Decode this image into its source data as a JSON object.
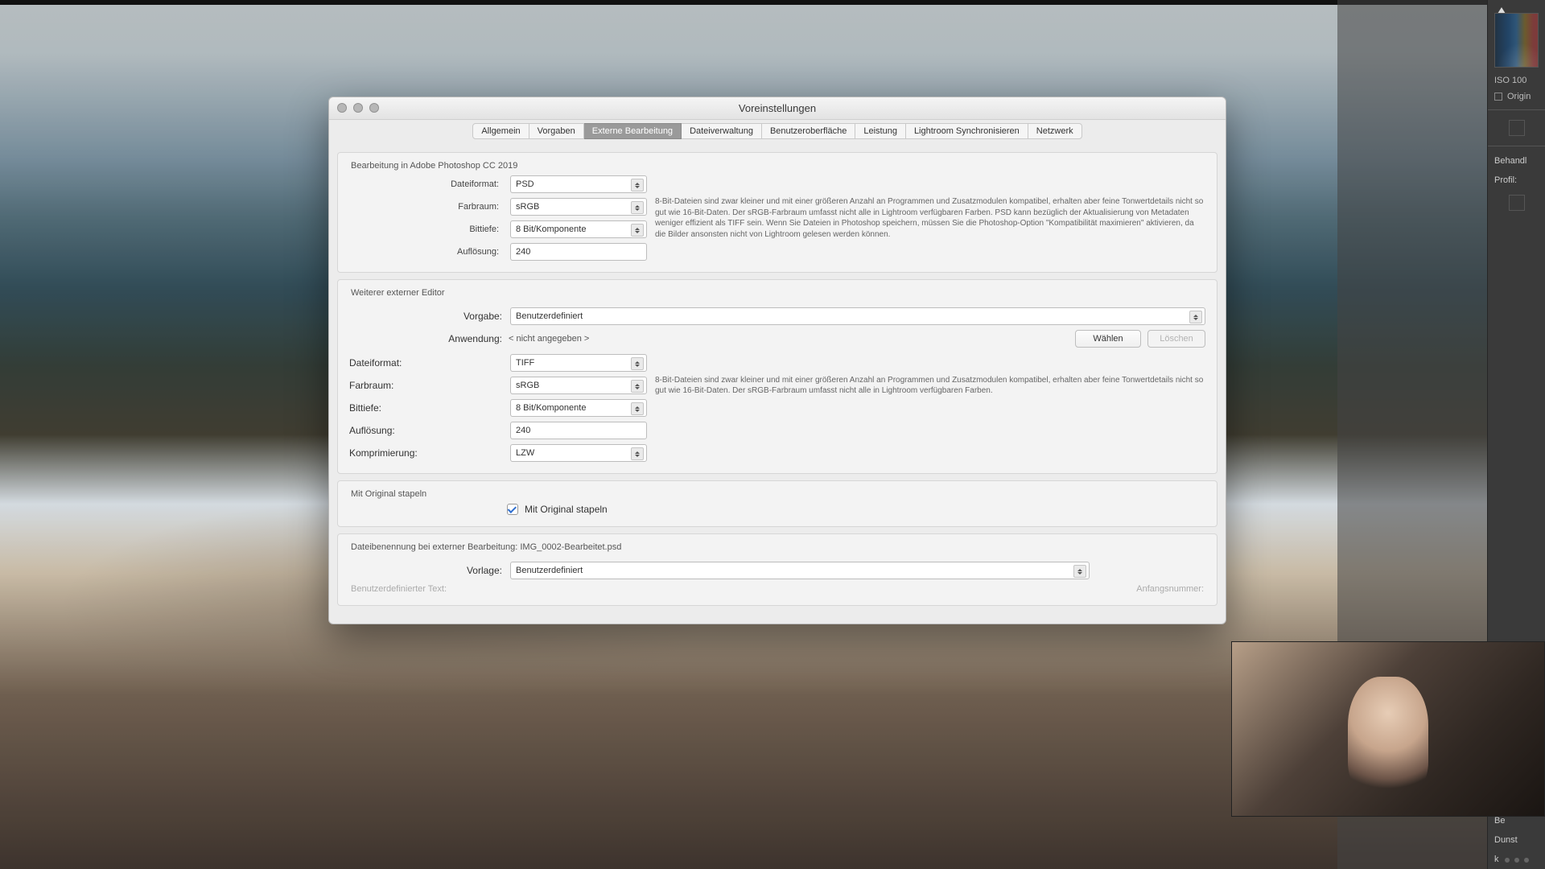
{
  "dialog": {
    "title": "Voreinstellungen",
    "tabs": [
      "Allgemein",
      "Vorgaben",
      "Externe Bearbeitung",
      "Dateiverwaltung",
      "Benutzeroberfläche",
      "Leistung",
      "Lightroom Synchronisieren",
      "Netzwerk"
    ],
    "active_tab_index": 2
  },
  "section1": {
    "title": "Bearbeitung in Adobe Photoshop CC 2019",
    "labels": {
      "dateiformat": "Dateiformat:",
      "farbraum": "Farbraum:",
      "bittiefe": "Bittiefe:",
      "aufloesung": "Auflösung:"
    },
    "values": {
      "dateiformat": "PSD",
      "farbraum": "sRGB",
      "bittiefe": "8 Bit/Komponente",
      "aufloesung": "240"
    },
    "info": "8-Bit-Dateien sind zwar kleiner und mit einer größeren Anzahl an Programmen und Zusatzmodulen kompatibel, erhalten aber feine Tonwertdetails nicht so gut wie 16-Bit-Daten. Der sRGB-Farbraum umfasst nicht alle in Lightroom verfügbaren Farben. PSD kann bezüglich der Aktualisierung von Metadaten weniger effizient als TIFF sein. Wenn Sie Dateien in Photoshop speichern, müssen Sie die Photoshop-Option \"Kompatibilität maximieren\" aktivieren, da die Bilder ansonsten nicht von Lightroom gelesen werden können."
  },
  "section2": {
    "title": "Weiterer externer Editor",
    "labels": {
      "vorgabe": "Vorgabe:",
      "anwendung": "Anwendung:",
      "dateiformat": "Dateiformat:",
      "farbraum": "Farbraum:",
      "bittiefe": "Bittiefe:",
      "aufloesung": "Auflösung:",
      "komprimierung": "Komprimierung:"
    },
    "values": {
      "vorgabe": "Benutzerdefiniert",
      "anwendung": "< nicht angegeben >",
      "dateiformat": "TIFF",
      "farbraum": "sRGB",
      "bittiefe": "8 Bit/Komponente",
      "aufloesung": "240",
      "komprimierung": "LZW"
    },
    "buttons": {
      "waehlen": "Wählen",
      "loeschen": "Löschen"
    },
    "info": "8-Bit-Dateien sind zwar kleiner und mit einer größeren Anzahl an Programmen und Zusatzmodulen kompatibel, erhalten aber feine Tonwertdetails nicht so gut wie 16-Bit-Daten. Der sRGB-Farbraum umfasst nicht alle in Lightroom verfügbaren Farben."
  },
  "section3": {
    "title": "Mit Original stapeln",
    "checkbox_label": "Mit Original stapeln",
    "checked": true
  },
  "section4": {
    "title": "Dateibenennung bei externer Bearbeitung: IMG_0002-Bearbeitet.psd",
    "labels": {
      "vorlage": "Vorlage:",
      "benutzerdef": "Benutzerdefinierter Text:",
      "anfang": "Anfangsnummer:"
    },
    "values": {
      "vorlage": "Benutzerdefiniert"
    }
  },
  "right": {
    "iso": "ISO 100",
    "origin": "Origin",
    "behandl": "Behandl",
    "profil": "Profil:",
    "be": "Be",
    "dunst1": "Dunst",
    "dunst2": "k"
  }
}
